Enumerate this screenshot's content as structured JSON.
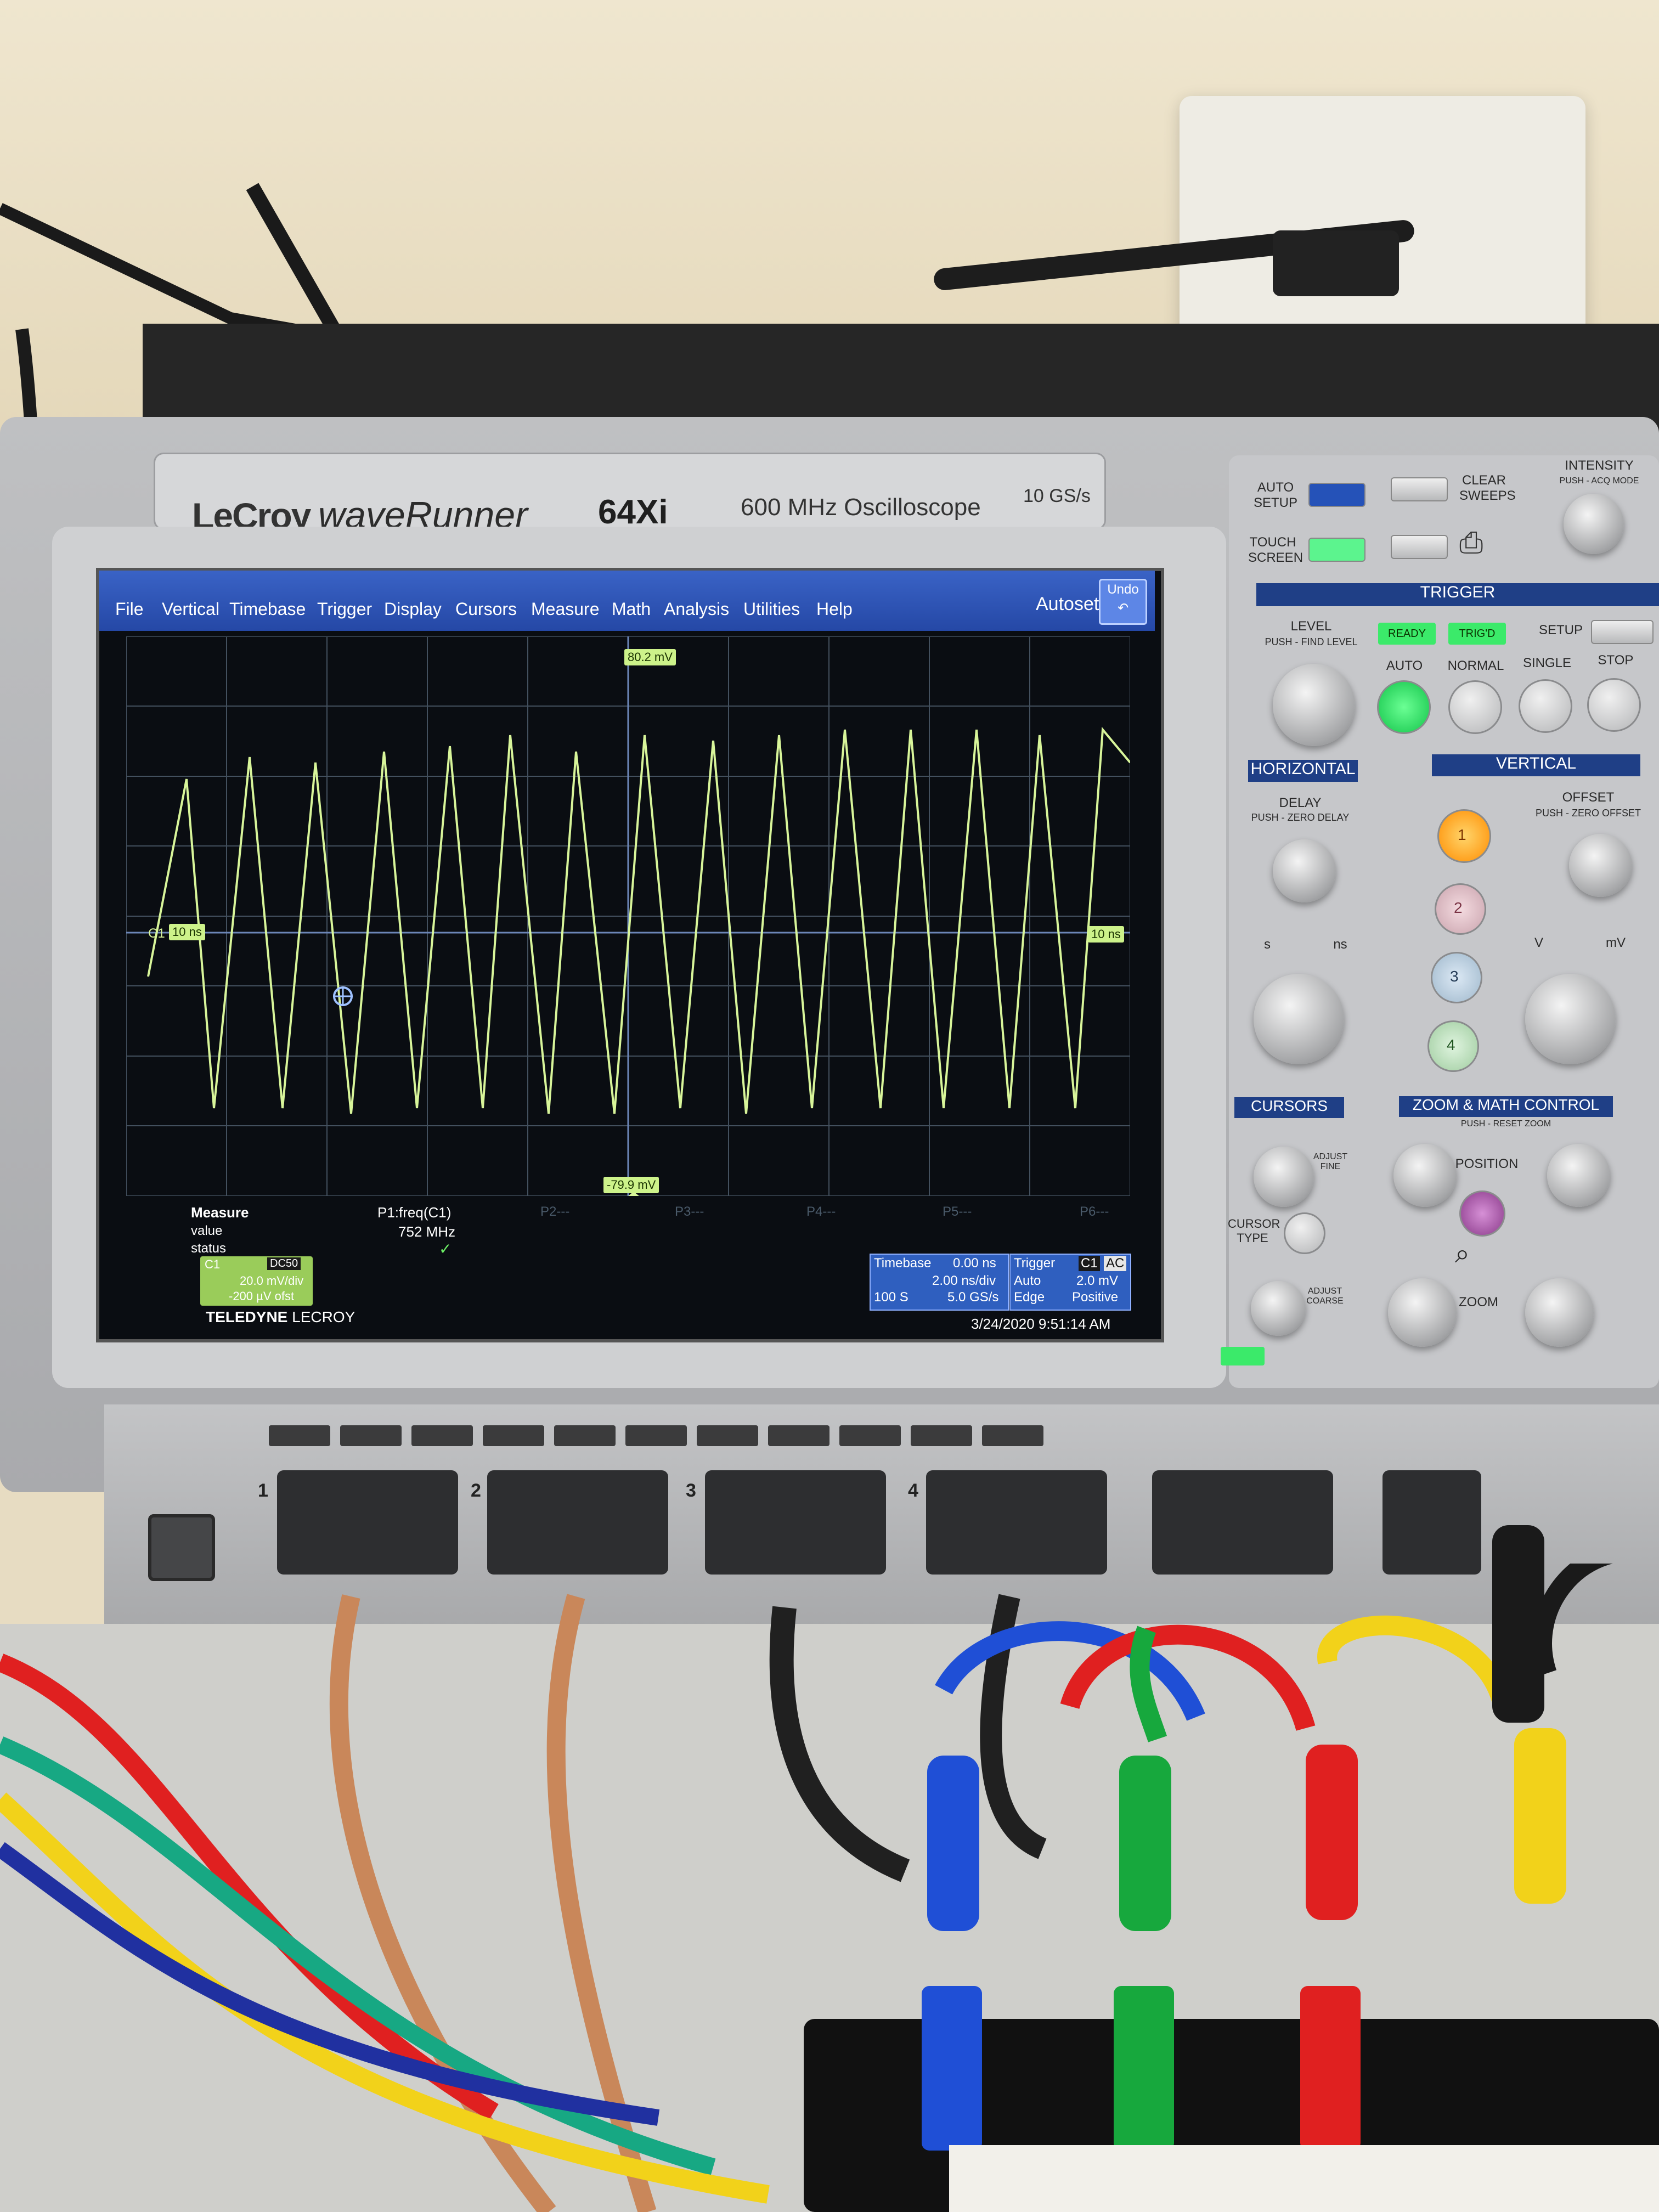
{
  "colors": {
    "menubar": "#2548a6",
    "trace": "#d8f59a",
    "grid": "#43505e",
    "trigger_section": "#1f3f86",
    "ready_lamp": "#3bea6a",
    "ch1_button": "#ff9f1a",
    "cable_blue": "#1f4fd6",
    "cable_green": "#17a83d",
    "cable_red": "#e02020",
    "cable_yellow": "#f2d21a",
    "cable_black": "#1a1a1a",
    "coax": "#c9875a"
  },
  "instrument": {
    "brand": "LeCroy",
    "series": "waveRunner",
    "model": "64Xi",
    "description": "600 MHz Oscilloscope",
    "sample_rate": "10 GS/s"
  },
  "menu": {
    "items": [
      "File",
      "Vertical",
      "Timebase",
      "Trigger",
      "Display",
      "Cursors",
      "Measure",
      "Math",
      "Analysis",
      "Utilities",
      "Help"
    ],
    "autoset_label": "Autoset:",
    "undo_label": "Undo"
  },
  "screen": {
    "top_marker": "80.2 mV",
    "bottom_marker": "-79.9 mV",
    "ch_label": "C1",
    "left_level_tag": "10 ns",
    "right_level_tag": "10 ns"
  },
  "measure": {
    "title": "Measure",
    "rows": [
      "value",
      "status"
    ],
    "p1_name": "P1:freq(C1)",
    "p1_value": "752 MHz",
    "p1_status": "✓",
    "slots": [
      "P2---",
      "P3---",
      "P4---",
      "P5---",
      "P6---"
    ]
  },
  "channel_box": {
    "name": "C1",
    "coupling": "DC50",
    "scale": "20.0 mV/div",
    "offset": "-200 µV ofst"
  },
  "timebase_box": {
    "title": "Timebase",
    "delay": "0.00 ns",
    "scale": "2.00 ns/div",
    "samples": "100 S",
    "rate": "5.0 GS/s"
  },
  "trigger_box": {
    "title": "Trigger",
    "source": "C1",
    "coupling": "AC",
    "mode": "Auto",
    "level": "2.0 mV",
    "type": "Edge",
    "slope": "Positive"
  },
  "footer": {
    "logo_teledyne": "TELEDYNE",
    "logo_lecroy": "LECROY",
    "datetime": "3/24/2020 9:51:14 AM"
  },
  "panel": {
    "auto_setup": "AUTO\nSETUP",
    "clear_sweeps": "CLEAR\nSWEEPS",
    "touch_screen": "TOUCH\nSCREEN",
    "intensity": "INTENSITY",
    "intensity_sub": "PUSH - ACQ MODE",
    "trigger_title": "TRIGGER",
    "level": "LEVEL",
    "level_sub": "PUSH - FIND LEVEL",
    "ready_lamp": "READY",
    "trigd_lamp": "TRIG'D",
    "setup": "SETUP",
    "mode_labels": [
      "AUTO",
      "NORMAL",
      "SINGLE",
      "STOP"
    ],
    "horizontal_title": "HORIZONTAL",
    "vertical_title": "VERTICAL",
    "delay": "DELAY",
    "delay_sub": "PUSH - ZERO DELAY",
    "offset": "OFFSET",
    "offset_sub": "PUSH - ZERO OFFSET",
    "time_units": [
      "s",
      "ns"
    ],
    "volt_units": [
      "V",
      "mV"
    ],
    "channels": [
      "1",
      "2",
      "3",
      "4"
    ],
    "cursors_title": "CURSORS",
    "zoom_title": "ZOOM & MATH CONTROL",
    "zoom_sub": "PUSH - RESET ZOOM",
    "adjust_fine": "ADJUST\nFINE",
    "adjust_coarse": "ADJUST\nCOARSE",
    "cursor_type": "CURSOR\nTYPE",
    "position": "POSITION",
    "zoom": "ZOOM"
  },
  "front_panel": {
    "inputs": [
      "1",
      "2",
      "3",
      "4"
    ]
  }
}
